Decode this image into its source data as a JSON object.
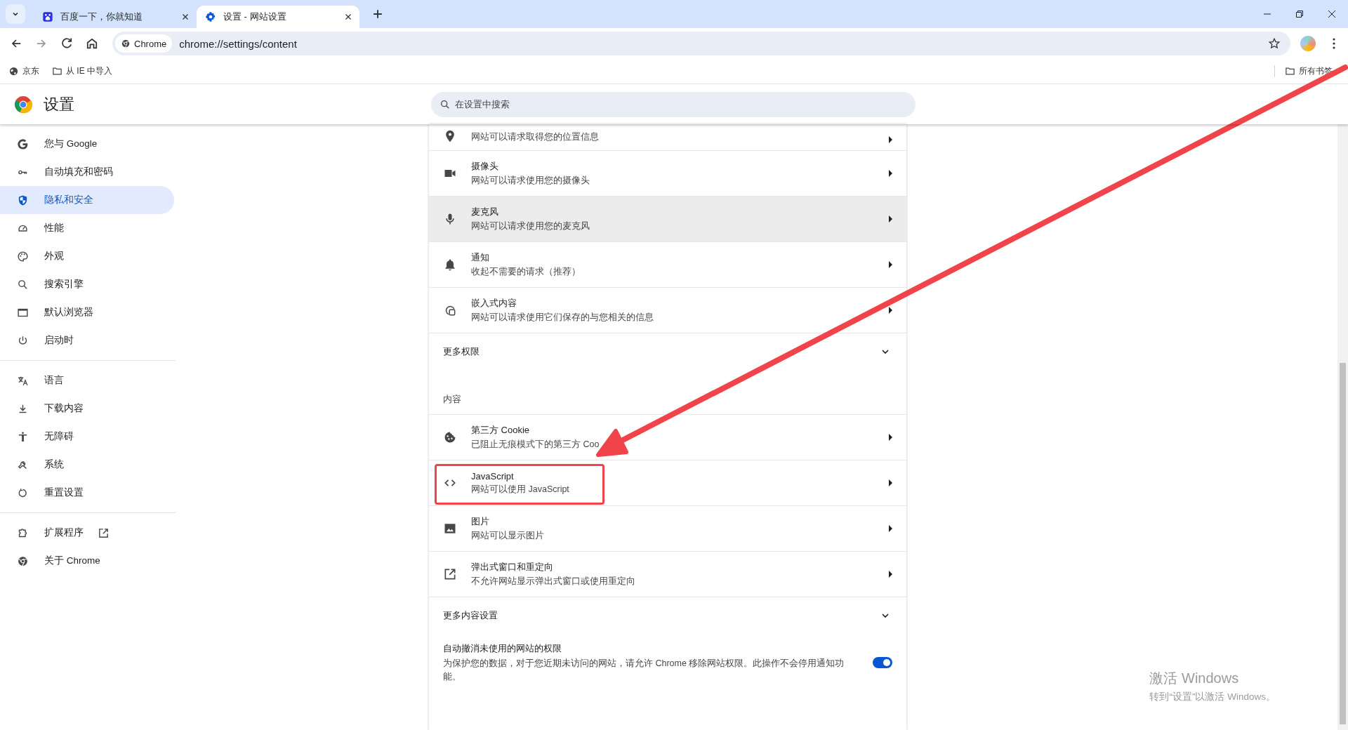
{
  "tabs": [
    {
      "title": "百度一下，你就知道",
      "kind": "paw",
      "selected": false
    },
    {
      "title": "设置 - 网站设置",
      "kind": "gear",
      "selected": true
    }
  ],
  "toolbar": {
    "site_chip": "Chrome",
    "url": "chrome://settings/content"
  },
  "bookmarks": [
    {
      "label": "京东",
      "kind": "globe"
    },
    {
      "label": "从 IE 中导入",
      "kind": "folder"
    }
  ],
  "all_bookmarks": "所有书签",
  "header": {
    "title": "设置",
    "search_placeholder": "在设置中搜索"
  },
  "sidebar": {
    "groups": [
      [
        {
          "label": "您与 Google",
          "kind": "google",
          "selected": false,
          "external": false
        },
        {
          "label": "自动填充和密码",
          "kind": "key",
          "selected": false,
          "external": false
        },
        {
          "label": "隐私和安全",
          "kind": "shield",
          "selected": true,
          "external": false
        },
        {
          "label": "性能",
          "kind": "gauge",
          "selected": false,
          "external": false
        },
        {
          "label": "外观",
          "kind": "palette",
          "selected": false,
          "external": false
        },
        {
          "label": "搜索引擎",
          "kind": "search",
          "selected": false,
          "external": false
        },
        {
          "label": "默认浏览器",
          "kind": "window",
          "selected": false,
          "external": false
        },
        {
          "label": "启动时",
          "kind": "power",
          "selected": false,
          "external": false
        }
      ],
      [
        {
          "label": "语言",
          "kind": "translate",
          "selected": false,
          "external": false
        },
        {
          "label": "下载内容",
          "kind": "download",
          "selected": false,
          "external": false
        },
        {
          "label": "无障碍",
          "kind": "person",
          "selected": false,
          "external": false
        },
        {
          "label": "系统",
          "kind": "wrench",
          "selected": false,
          "external": false
        },
        {
          "label": "重置设置",
          "kind": "reset",
          "selected": false,
          "external": false
        }
      ],
      [
        {
          "label": "扩展程序",
          "kind": "puzzle",
          "selected": false,
          "external": true
        },
        {
          "label": "关于 Chrome",
          "kind": "chrome",
          "selected": false,
          "external": false
        }
      ]
    ]
  },
  "content": [
    {
      "kind": "pin",
      "description": "网站可以请求取得您的位置信息",
      "highlighted": false,
      "outlined": false
    },
    {
      "kind": "camera",
      "title": "摄像头",
      "description": "网站可以请求使用您的摄像头",
      "highlighted": false,
      "outlined": false
    },
    {
      "kind": "mic",
      "title": "麦克风",
      "description": "网站可以请求使用您的麦克风",
      "highlighted": true,
      "outlined": false
    },
    {
      "kind": "bell",
      "title": "通知",
      "description": "收起不需要的请求（推荐）",
      "highlighted": false,
      "outlined": false
    },
    {
      "kind": "embed",
      "title": "嵌入式内容",
      "description": "网站可以请求使用它们保存的与您相关的信息",
      "highlighted": false,
      "outlined": false
    },
    {
      "kind": "section",
      "title": "更多权限",
      "expanded": false
    },
    {
      "kind": "label",
      "title": "内容"
    },
    {
      "kind": "cookie",
      "title": "第三方 Cookie",
      "description": "已阻止无痕模式下的第三方 Coo",
      "highlighted": false,
      "outlined": false
    },
    {
      "kind": "code",
      "title": "JavaScript",
      "description": "网站可以使用 JavaScript",
      "highlighted": false,
      "outlined": true
    },
    {
      "kind": "image",
      "title": "图片",
      "description": "网站可以显示图片",
      "highlighted": false,
      "outlined": false
    },
    {
      "kind": "popup",
      "title": "弹出式窗口和重定向",
      "description": "不允许网站显示弹出式窗口或使用重定向",
      "highlighted": false,
      "outlined": false
    },
    {
      "kind": "section",
      "title": "更多内容设置",
      "expanded": false
    },
    {
      "kind": "toggle",
      "title": "自动撤消未使用的网站的权限",
      "description": "为保护您的数据，对于您近期未访问的网站，请允许 Chrome 移除网站权限。此操作不会停用通知功能。",
      "on": true
    }
  ],
  "os_watermark": {
    "title": "激活 Windows",
    "subtitle": "转到“设置”以激活 Windows。"
  }
}
